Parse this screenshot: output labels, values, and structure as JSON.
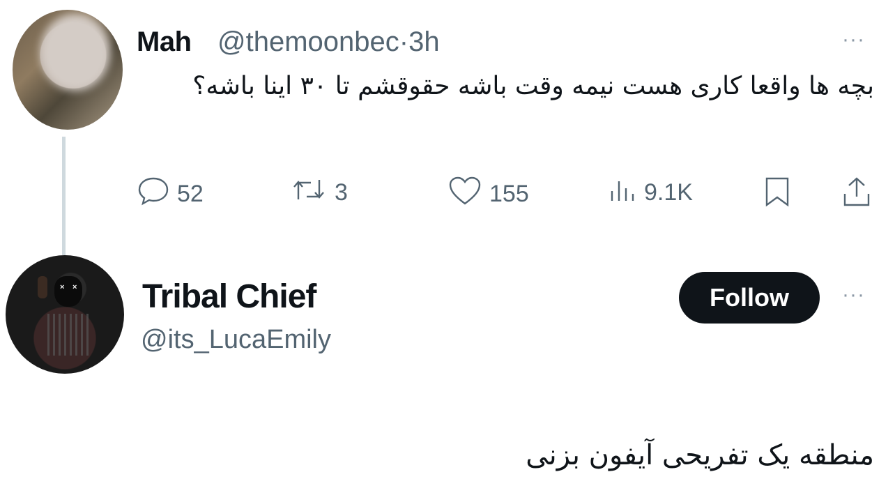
{
  "original_tweet": {
    "name": "Mah",
    "handle": "@themoonbec",
    "separator": "·",
    "time": "3h",
    "more_icon": "···",
    "text": "بچه ها واقعا کاری هست نیمه وقت باشه حقوقشم  تا ۳۰ اینا باشه؟",
    "actions": {
      "replies": "52",
      "retweets": "3",
      "likes": "155",
      "views": "9.1K"
    }
  },
  "reply_tweet": {
    "name": "Tribal Chief",
    "handle": "@its_LucaEmily",
    "follow_label": "Follow",
    "more_icon": "···",
    "text": "منطقه یک تفریحی آیفون بزنی"
  },
  "colors": {
    "text_primary": "#0f1419",
    "text_secondary": "#536471",
    "thread_line": "#cfd9de",
    "follow_bg": "#0f1419"
  },
  "icons": [
    "reply-icon",
    "retweet-icon",
    "like-icon",
    "views-icon",
    "bookmark-icon",
    "share-icon",
    "more-icon"
  ]
}
